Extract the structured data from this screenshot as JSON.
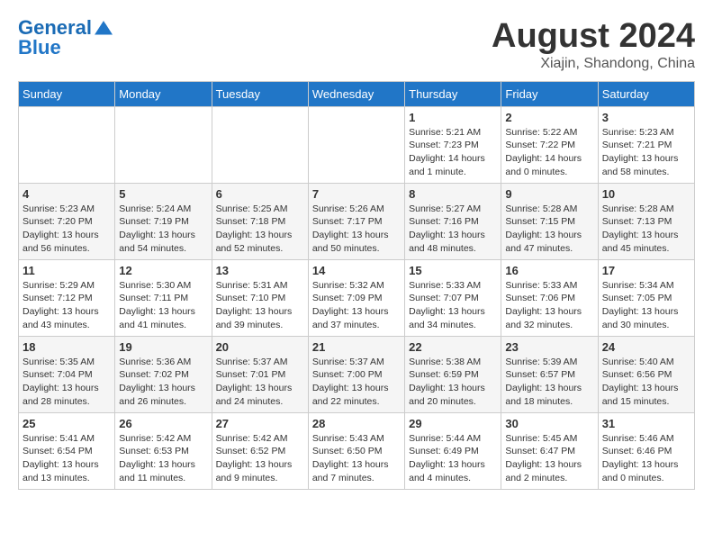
{
  "header": {
    "logo_line1": "General",
    "logo_line2": "Blue",
    "month_year": "August 2024",
    "location": "Xiajin, Shandong, China"
  },
  "weekdays": [
    "Sunday",
    "Monday",
    "Tuesday",
    "Wednesday",
    "Thursday",
    "Friday",
    "Saturday"
  ],
  "weeks": [
    [
      {
        "day": "",
        "info": ""
      },
      {
        "day": "",
        "info": ""
      },
      {
        "day": "",
        "info": ""
      },
      {
        "day": "",
        "info": ""
      },
      {
        "day": "1",
        "info": "Sunrise: 5:21 AM\nSunset: 7:23 PM\nDaylight: 14 hours\nand 1 minute."
      },
      {
        "day": "2",
        "info": "Sunrise: 5:22 AM\nSunset: 7:22 PM\nDaylight: 14 hours\nand 0 minutes."
      },
      {
        "day": "3",
        "info": "Sunrise: 5:23 AM\nSunset: 7:21 PM\nDaylight: 13 hours\nand 58 minutes."
      }
    ],
    [
      {
        "day": "4",
        "info": "Sunrise: 5:23 AM\nSunset: 7:20 PM\nDaylight: 13 hours\nand 56 minutes."
      },
      {
        "day": "5",
        "info": "Sunrise: 5:24 AM\nSunset: 7:19 PM\nDaylight: 13 hours\nand 54 minutes."
      },
      {
        "day": "6",
        "info": "Sunrise: 5:25 AM\nSunset: 7:18 PM\nDaylight: 13 hours\nand 52 minutes."
      },
      {
        "day": "7",
        "info": "Sunrise: 5:26 AM\nSunset: 7:17 PM\nDaylight: 13 hours\nand 50 minutes."
      },
      {
        "day": "8",
        "info": "Sunrise: 5:27 AM\nSunset: 7:16 PM\nDaylight: 13 hours\nand 48 minutes."
      },
      {
        "day": "9",
        "info": "Sunrise: 5:28 AM\nSunset: 7:15 PM\nDaylight: 13 hours\nand 47 minutes."
      },
      {
        "day": "10",
        "info": "Sunrise: 5:28 AM\nSunset: 7:13 PM\nDaylight: 13 hours\nand 45 minutes."
      }
    ],
    [
      {
        "day": "11",
        "info": "Sunrise: 5:29 AM\nSunset: 7:12 PM\nDaylight: 13 hours\nand 43 minutes."
      },
      {
        "day": "12",
        "info": "Sunrise: 5:30 AM\nSunset: 7:11 PM\nDaylight: 13 hours\nand 41 minutes."
      },
      {
        "day": "13",
        "info": "Sunrise: 5:31 AM\nSunset: 7:10 PM\nDaylight: 13 hours\nand 39 minutes."
      },
      {
        "day": "14",
        "info": "Sunrise: 5:32 AM\nSunset: 7:09 PM\nDaylight: 13 hours\nand 37 minutes."
      },
      {
        "day": "15",
        "info": "Sunrise: 5:33 AM\nSunset: 7:07 PM\nDaylight: 13 hours\nand 34 minutes."
      },
      {
        "day": "16",
        "info": "Sunrise: 5:33 AM\nSunset: 7:06 PM\nDaylight: 13 hours\nand 32 minutes."
      },
      {
        "day": "17",
        "info": "Sunrise: 5:34 AM\nSunset: 7:05 PM\nDaylight: 13 hours\nand 30 minutes."
      }
    ],
    [
      {
        "day": "18",
        "info": "Sunrise: 5:35 AM\nSunset: 7:04 PM\nDaylight: 13 hours\nand 28 minutes."
      },
      {
        "day": "19",
        "info": "Sunrise: 5:36 AM\nSunset: 7:02 PM\nDaylight: 13 hours\nand 26 minutes."
      },
      {
        "day": "20",
        "info": "Sunrise: 5:37 AM\nSunset: 7:01 PM\nDaylight: 13 hours\nand 24 minutes."
      },
      {
        "day": "21",
        "info": "Sunrise: 5:37 AM\nSunset: 7:00 PM\nDaylight: 13 hours\nand 22 minutes."
      },
      {
        "day": "22",
        "info": "Sunrise: 5:38 AM\nSunset: 6:59 PM\nDaylight: 13 hours\nand 20 minutes."
      },
      {
        "day": "23",
        "info": "Sunrise: 5:39 AM\nSunset: 6:57 PM\nDaylight: 13 hours\nand 18 minutes."
      },
      {
        "day": "24",
        "info": "Sunrise: 5:40 AM\nSunset: 6:56 PM\nDaylight: 13 hours\nand 15 minutes."
      }
    ],
    [
      {
        "day": "25",
        "info": "Sunrise: 5:41 AM\nSunset: 6:54 PM\nDaylight: 13 hours\nand 13 minutes."
      },
      {
        "day": "26",
        "info": "Sunrise: 5:42 AM\nSunset: 6:53 PM\nDaylight: 13 hours\nand 11 minutes."
      },
      {
        "day": "27",
        "info": "Sunrise: 5:42 AM\nSunset: 6:52 PM\nDaylight: 13 hours\nand 9 minutes."
      },
      {
        "day": "28",
        "info": "Sunrise: 5:43 AM\nSunset: 6:50 PM\nDaylight: 13 hours\nand 7 minutes."
      },
      {
        "day": "29",
        "info": "Sunrise: 5:44 AM\nSunset: 6:49 PM\nDaylight: 13 hours\nand 4 minutes."
      },
      {
        "day": "30",
        "info": "Sunrise: 5:45 AM\nSunset: 6:47 PM\nDaylight: 13 hours\nand 2 minutes."
      },
      {
        "day": "31",
        "info": "Sunrise: 5:46 AM\nSunset: 6:46 PM\nDaylight: 13 hours\nand 0 minutes."
      }
    ]
  ]
}
